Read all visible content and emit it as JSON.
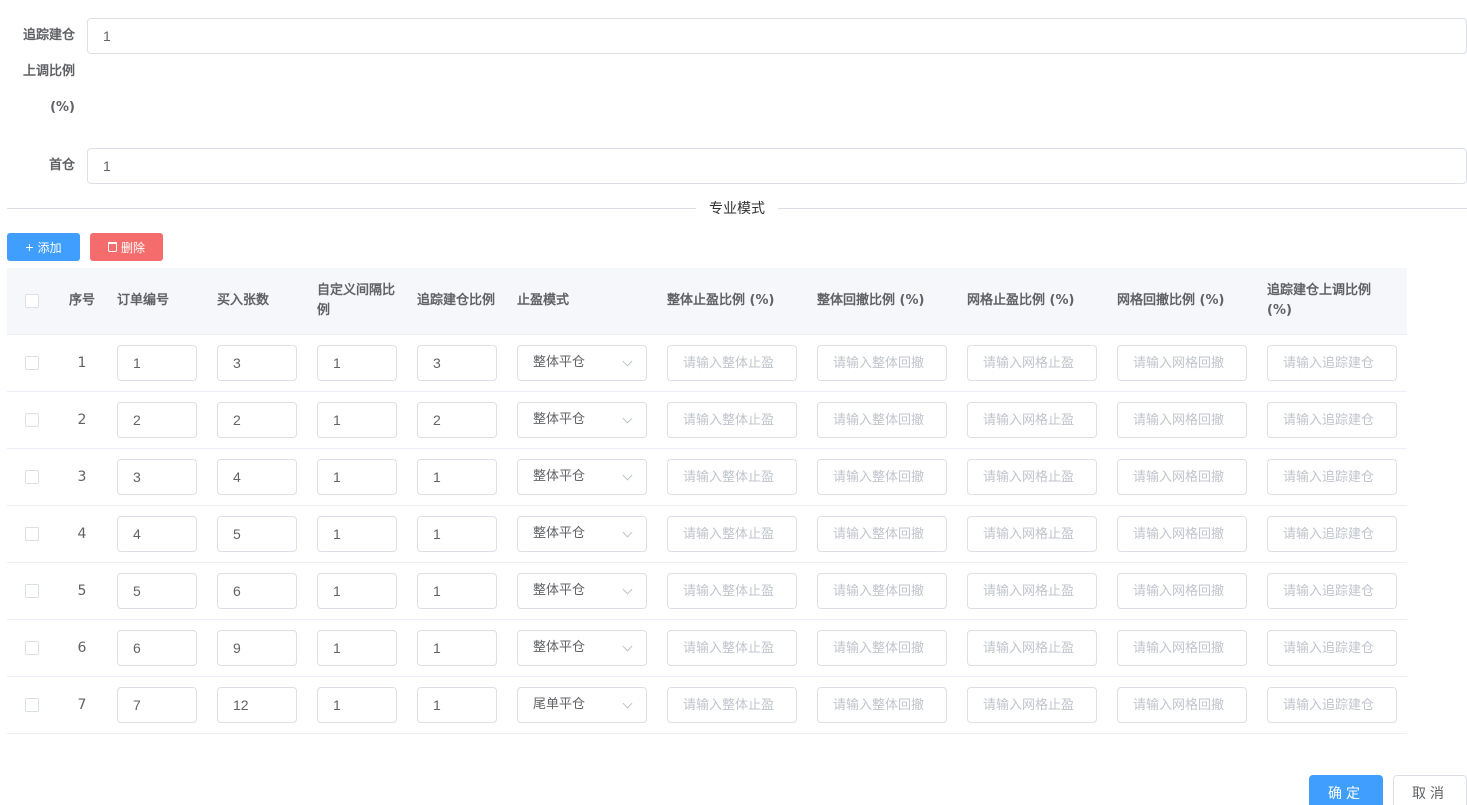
{
  "form": {
    "track_ratio_label_1": "追踪建仓",
    "track_ratio_label_2": "上调比例",
    "track_ratio_label_3": "(%)",
    "track_ratio_value": "1",
    "first_position_label": "首仓",
    "first_position_value": "1"
  },
  "divider_text": "专业模式",
  "toolbar": {
    "add_label": "添加",
    "delete_label": "删除"
  },
  "table": {
    "headers": {
      "index": "序号",
      "order_no": "订单编号",
      "buy_qty": "买入张数",
      "custom_interval_1": "自定义间隔比",
      "custom_interval_2": "例",
      "track_ratio": "追踪建仓比例",
      "tp_mode": "止盈模式",
      "overall_tp": "整体止盈比例 (%)",
      "overall_pullback": "整体回撤比例 (%)",
      "grid_tp": "网格止盈比例 (%)",
      "grid_pullback": "网格回撤比例 (%)",
      "track_up": "追踪建仓上调比例 (%)"
    },
    "placeholders": {
      "overall_tp": "请输入整体止盈",
      "overall_pullback": "请输入整体回撤",
      "grid_tp": "请输入网格止盈",
      "grid_pullback": "请输入网格回撤",
      "track_up": "请输入追踪建仓"
    },
    "rows": [
      {
        "index": "1",
        "order_no": "1",
        "buy_qty": "3",
        "interval": "1",
        "track": "3",
        "mode": "整体平仓"
      },
      {
        "index": "2",
        "order_no": "2",
        "buy_qty": "2",
        "interval": "1",
        "track": "2",
        "mode": "整体平仓"
      },
      {
        "index": "3",
        "order_no": "3",
        "buy_qty": "4",
        "interval": "1",
        "track": "1",
        "mode": "整体平仓"
      },
      {
        "index": "4",
        "order_no": "4",
        "buy_qty": "5",
        "interval": "1",
        "track": "1",
        "mode": "整体平仓"
      },
      {
        "index": "5",
        "order_no": "5",
        "buy_qty": "6",
        "interval": "1",
        "track": "1",
        "mode": "整体平仓"
      },
      {
        "index": "6",
        "order_no": "6",
        "buy_qty": "9",
        "interval": "1",
        "track": "1",
        "mode": "整体平仓"
      },
      {
        "index": "7",
        "order_no": "7",
        "buy_qty": "12",
        "interval": "1",
        "track": "1",
        "mode": "尾单平仓"
      }
    ]
  },
  "footer": {
    "confirm_label": "确定",
    "cancel_label": "取消"
  },
  "colors": {
    "primary": "#409eff",
    "danger": "#f56c6c",
    "border": "#dcdfe6"
  }
}
